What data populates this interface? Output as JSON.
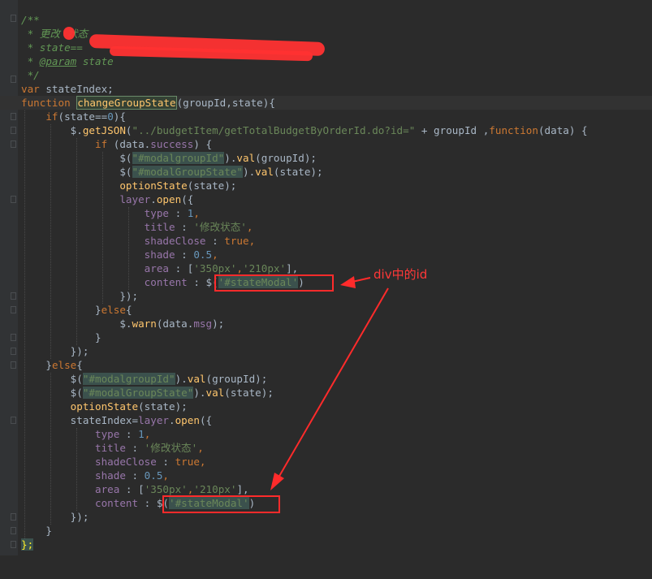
{
  "colors": {
    "background": "#2b2b2b",
    "gutter": "#313335",
    "keyword": "#cc7832",
    "function": "#ffc66d",
    "string": "#6a8759",
    "number": "#6897bb",
    "property": "#9876aa",
    "comment": "#629755",
    "annotation": "#ff2b2b"
  },
  "code": {
    "line1": "/**",
    "line2": " * 更改",
    "line2_tail": "状态",
    "line3": " * state==",
    "line4_star": " * ",
    "line4_tag": "@param",
    "line4_rest": " state",
    "line5": " */",
    "var_kw": "var",
    "var_name": " stateIndex;",
    "function_kw": "function",
    "function_name": "changeGroupState",
    "function_params": "(groupId,state){",
    "if_kw": "if",
    "if_cond_a": "(state==",
    "if_cond_num": "0",
    "if_cond_b": "){",
    "getjson_prefix": "$.",
    "getjson_fn": "getJSON",
    "getjson_open": "(",
    "getjson_url": "\"../budgetItem/getTotalBudgetByOrderId.do?id=\"",
    "getjson_plus": " + groupId ,",
    "getjson_function_kw": "function",
    "getjson_tail": "(data) {",
    "if2_kw": "if",
    "if2_a": " (data.",
    "if2_prop": "success",
    "if2_b": ") {",
    "jq_dollar": "$(",
    "sel_modalgroupid": "\"#modalgroupId\"",
    "val_dot": ").",
    "val_fn": "val",
    "val_arg_groupid": "(groupId);",
    "sel_modalgroupstate": "\"#modalGroupState\"",
    "val_arg_state": "(state);",
    "option_state_fn": "optionState",
    "option_state_args": "(state);",
    "layer_obj": "layer",
    "layer_dot": ".",
    "layer_open_fn": "open",
    "layer_open_tail": "({",
    "key_type": "type",
    "key_title": "title",
    "key_shadeclose": "shadeClose",
    "key_shade": "shade",
    "key_area": "area",
    "key_content": "content",
    "colon": " : ",
    "val_type": "1",
    "val_title": "'修改状态'",
    "val_shadeclose": "true",
    "val_shade": "0.5",
    "area_open": "[",
    "area_a": "'350px'",
    "area_comma": ",",
    "area_b": "'210px'",
    "area_close": "],",
    "comma": ",",
    "content_dollar": "$(",
    "content_sel": "'#stateModal'",
    "content_close": ")",
    "close_obj": "});",
    "else_open_a": "}",
    "else_kw": "else",
    "else_open_b": "{",
    "warn_dollar": "$.",
    "warn_fn": "warn",
    "warn_a": "(data.",
    "warn_prop": "msg",
    "warn_b": ");",
    "close_brace": "}",
    "close_paren": "});",
    "state_index_a": "stateIndex=",
    "close_fn": "};"
  },
  "annotations": {
    "label": "div中的id"
  }
}
